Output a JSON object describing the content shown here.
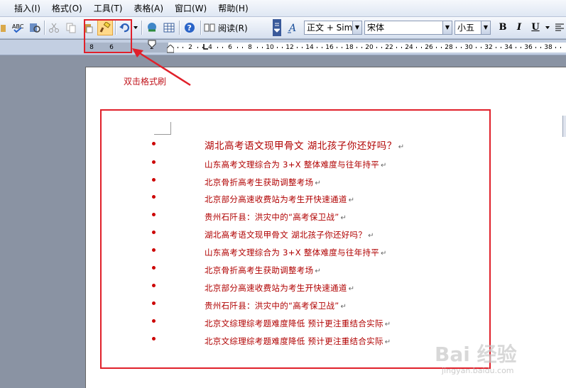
{
  "menu": {
    "items": [
      "插入(I)",
      "格式(O)",
      "工具(T)",
      "表格(A)",
      "窗口(W)",
      "帮助(H)"
    ]
  },
  "toolbar": {
    "reading_label": "阅读(R)",
    "style_value": "正文 + Sim",
    "font_value": "宋体",
    "size_value": "小五",
    "bold": "B",
    "italic": "I",
    "underline": "U"
  },
  "ruler": {
    "labels": [
      "8",
      "6",
      "2",
      "2",
      "4",
      "6",
      "8",
      "10",
      "12",
      "14",
      "16",
      "18",
      "20",
      "22",
      "24",
      "26",
      "28",
      "30",
      "32",
      "34",
      "36",
      "38"
    ]
  },
  "annotation": {
    "text": "双击格式刷"
  },
  "document": {
    "paragraph_mark": "↵",
    "items": [
      "湖北高考语文现甲骨文  湖北孩子你还好吗？",
      "山东高考文理综合为 3+X 整体难度与往年持平",
      "北京骨折高考生获助调整考场",
      "北京部分高速收费站为考生开快速通道",
      "贵州石阡县：洪灾中的“高考保卫战”",
      "湖北高考语文现甲骨文  湖北孩子你还好吗？",
      "山东高考文理综合为 3+X 整体难度与往年持平",
      "北京骨折高考生获助调整考场",
      "北京部分高速收费站为考生开快速通道",
      "贵州石阡县：洪灾中的“高考保卫战”",
      "北京文综理综考题难度降低  预计更注重结合实际",
      "北京文综理综考题难度降低  预计更注重结合实际"
    ]
  },
  "watermark": {
    "logo": "Bai 经验",
    "url": "jingyan.baidu.com"
  },
  "colors": {
    "accent_red": "#e0202a",
    "text_red": "#b00000"
  }
}
